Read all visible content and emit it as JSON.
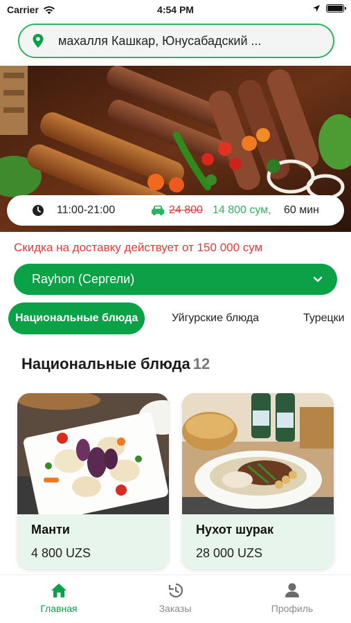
{
  "status": {
    "carrier": "Carrier",
    "time": "4:54 PM"
  },
  "address": {
    "text": "махалля Кашкар, Юнусабадский ..."
  },
  "restaurant": {
    "hours": "11:00-21:00",
    "delivery_old_price": "24 800",
    "delivery_new_price": "14 800 сум,",
    "delivery_time": "60 мин",
    "discount_note": "Скидка на доставку действует от 150 000 сум",
    "branch": "Rayhon (Сергели)"
  },
  "tabs": [
    {
      "label": "Национальные блюда",
      "active": true
    },
    {
      "label": "Уйгурские блюда",
      "active": false
    },
    {
      "label": "Турецки",
      "active": false
    }
  ],
  "section": {
    "title": "Национальные блюда",
    "count": "12"
  },
  "products": [
    {
      "name": "Манти",
      "price": "4 800 UZS"
    },
    {
      "name": "Нухот шурак",
      "price": "28 000 UZS"
    }
  ],
  "tabbar": [
    {
      "label": "Главная",
      "icon": "home-icon",
      "active": true
    },
    {
      "label": "Заказы",
      "icon": "history-icon",
      "active": false
    },
    {
      "label": "Профиль",
      "icon": "profile-icon",
      "active": false
    }
  ],
  "colors": {
    "accent": "#0aa147",
    "border_green": "#2db35d",
    "discount_red": "#e53935",
    "card_bg": "#e8f5ec"
  }
}
